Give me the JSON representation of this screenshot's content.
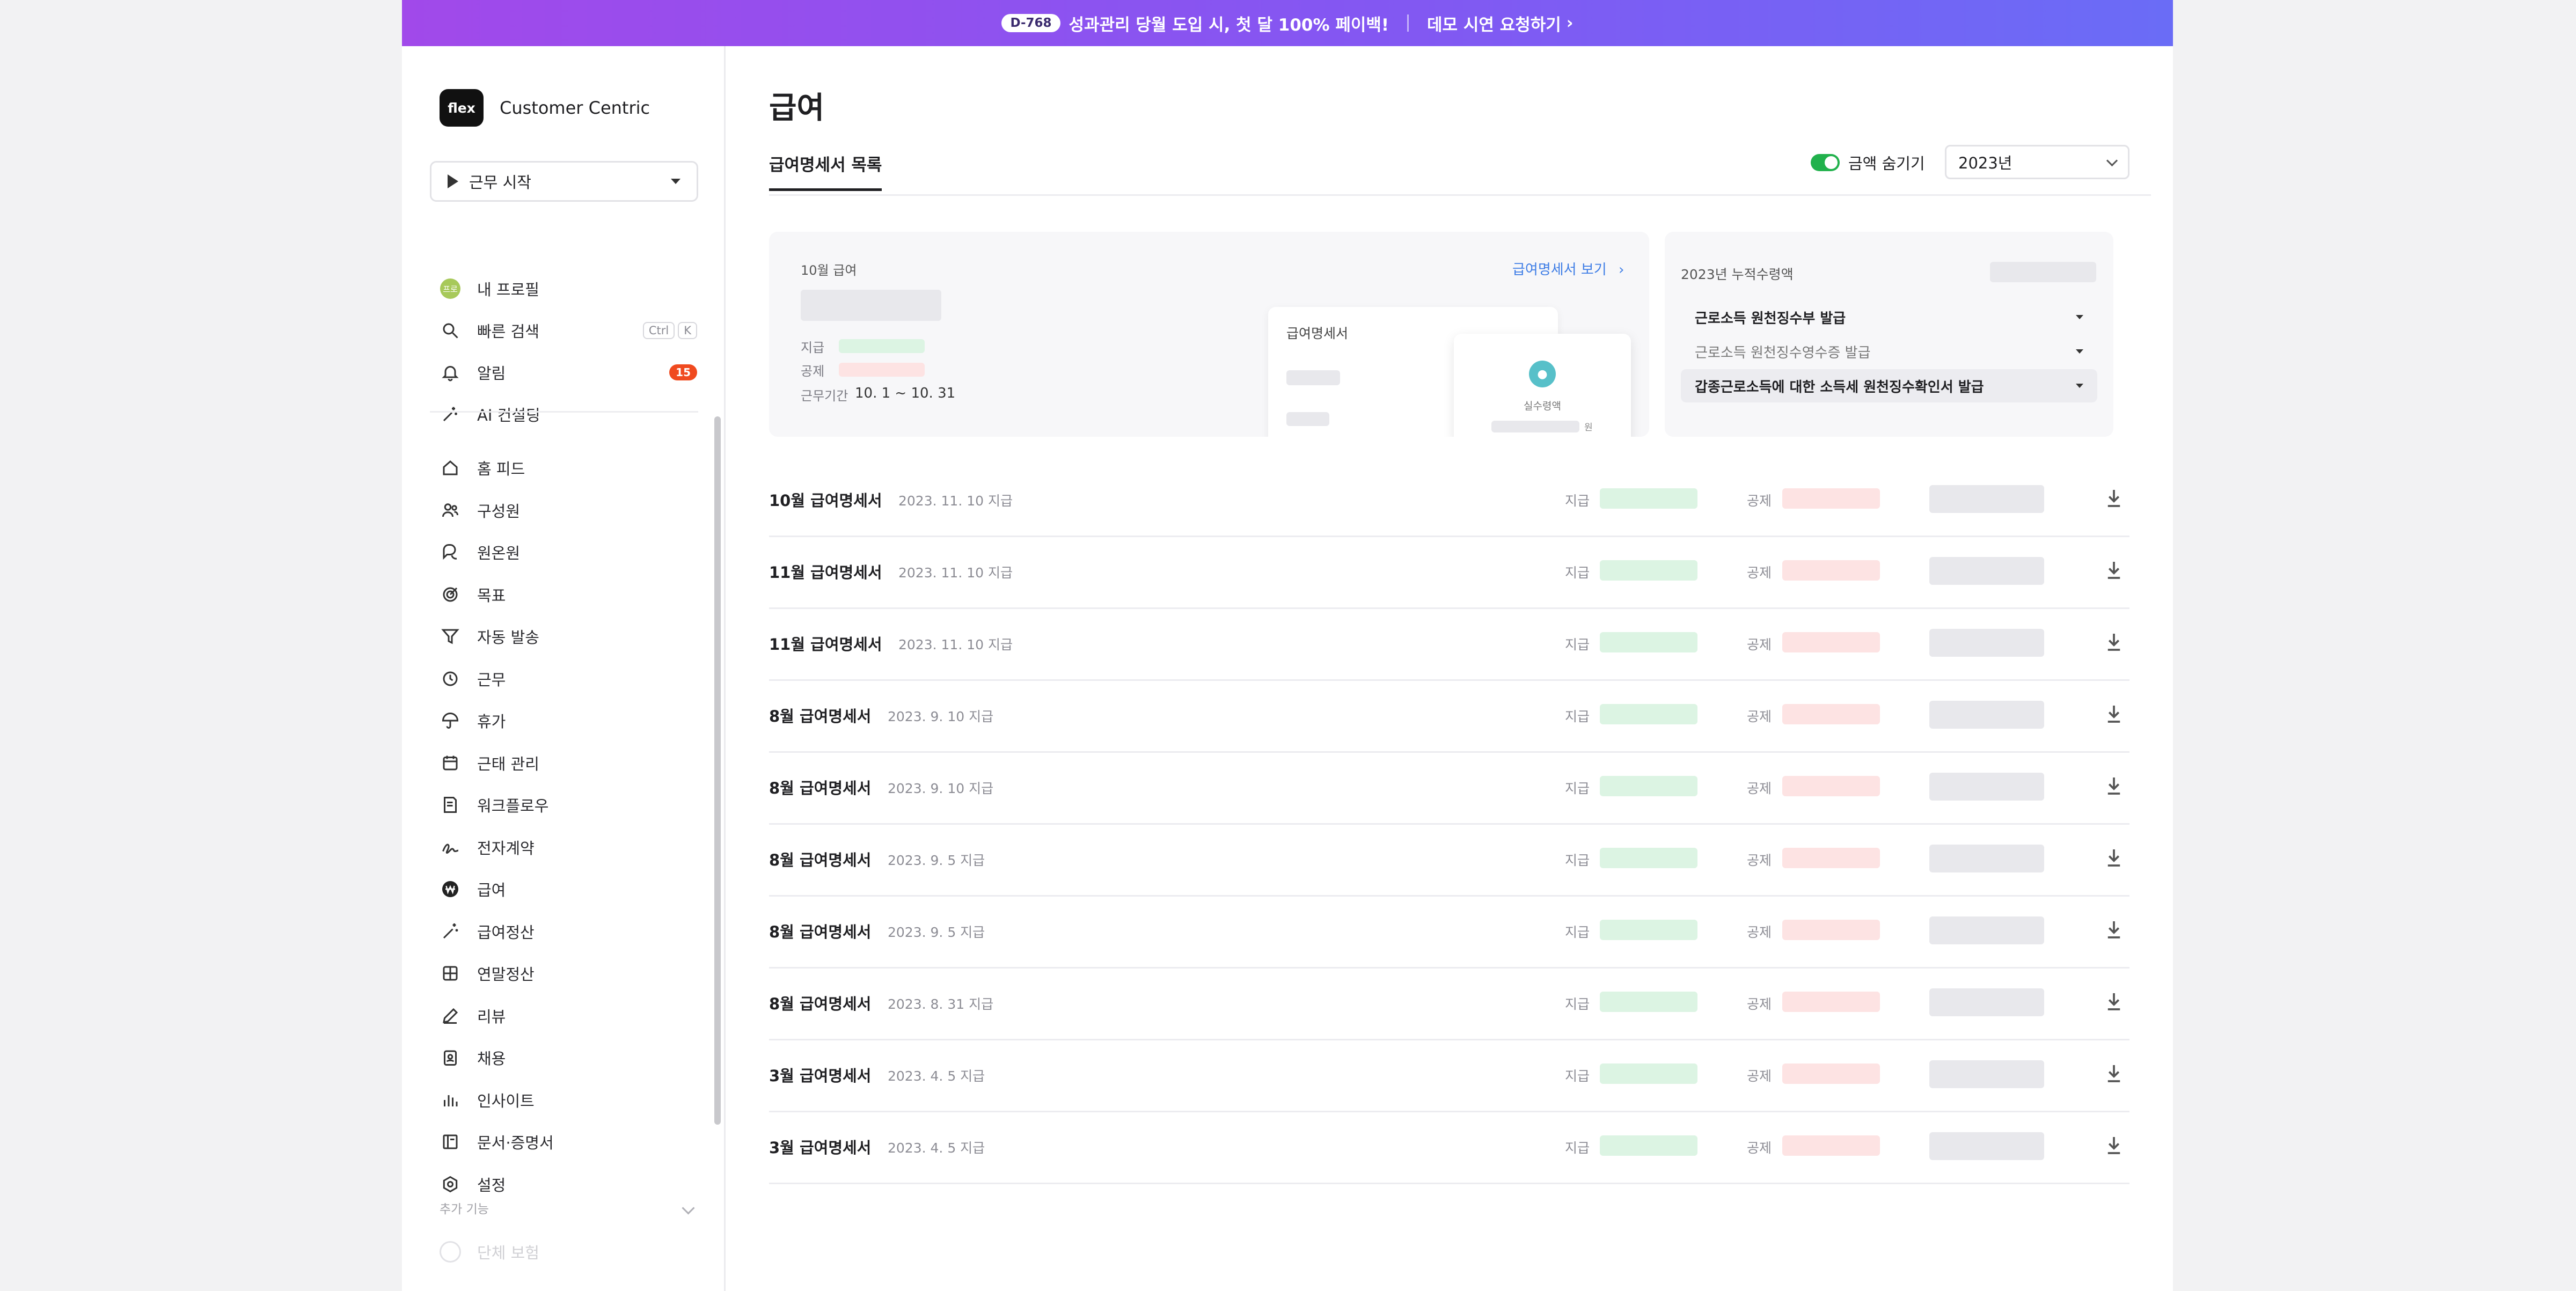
{
  "banner": {
    "dday": "D-768",
    "promo": "성과관리 당월 도입 시, 첫 달 100% 페이백!",
    "cta": "데모 시연 요청하기",
    "chevron": "›"
  },
  "sidebar": {
    "logo": "flex",
    "company": "Customer Centric",
    "work_start": "근무 시작",
    "quick_items": [
      {
        "label": "내 프로필",
        "icon": "profile-avatar",
        "avatar_text": "프로"
      },
      {
        "label": "빠른 검색",
        "icon": "search-icon",
        "shortcut": [
          "Ctrl",
          "K"
        ]
      },
      {
        "label": "알림",
        "icon": "bell-icon",
        "badge": "15"
      },
      {
        "label": "AI 컨설팅",
        "icon": "sparkle-icon"
      }
    ],
    "menu": [
      {
        "label": "홈 피드",
        "icon": "home-icon"
      },
      {
        "label": "구성원",
        "icon": "people-icon"
      },
      {
        "label": "원온원",
        "icon": "chat-icon"
      },
      {
        "label": "목표",
        "icon": "target-icon"
      },
      {
        "label": "자동 발송",
        "icon": "send-icon"
      },
      {
        "label": "근무",
        "icon": "clock-icon"
      },
      {
        "label": "휴가",
        "icon": "umbrella-icon"
      },
      {
        "label": "근태 관리",
        "icon": "calendar-icon"
      },
      {
        "label": "워크플로우",
        "icon": "document-icon"
      },
      {
        "label": "전자계약",
        "icon": "signature-icon"
      },
      {
        "label": "급여",
        "icon": "won-icon"
      },
      {
        "label": "급여정산",
        "icon": "wand-icon"
      },
      {
        "label": "연말정산",
        "icon": "grid-icon"
      },
      {
        "label": "리뷰",
        "icon": "pen-icon"
      },
      {
        "label": "채용",
        "icon": "badge-icon"
      },
      {
        "label": "인사이트",
        "icon": "bar-chart-icon"
      },
      {
        "label": "문서·증명서",
        "icon": "docs-icon"
      },
      {
        "label": "설정",
        "icon": "gear-icon"
      }
    ],
    "extra_label": "추가 기능",
    "faded_item": "단체 보험"
  },
  "main": {
    "title": "급여",
    "tab": "급여명세서 목록",
    "toggle_label": "금액 숨기기",
    "year": "2023년",
    "summary": {
      "title": "10월 급여",
      "link": "급여명세서 보기",
      "pay_label": "지급",
      "deduct_label": "공제",
      "period_label": "근무기간",
      "period_value": "10. 1 ~ 10. 31",
      "preview_title": "급여명세서",
      "preview_net": "실수령액",
      "preview_won": "원"
    },
    "cumulative": {
      "title": "2023년 누적수령액",
      "items": [
        "근로소득 원천징수부 발급",
        "근로소득 원천징수영수증 발급",
        "갑종근로소득에 대한 소득세 원천징수확인서 발급"
      ]
    },
    "pay_label": "지급",
    "deduct_label": "공제",
    "rows": [
      {
        "name": "10월 급여명세서",
        "date": "2023. 11. 10 지급"
      },
      {
        "name": "11월 급여명세서",
        "date": "2023. 11. 10 지급"
      },
      {
        "name": "11월 급여명세서",
        "date": "2023. 11. 10 지급"
      },
      {
        "name": "8월 급여명세서",
        "date": "2023. 9. 10 지급"
      },
      {
        "name": "8월 급여명세서",
        "date": "2023. 9. 10 지급"
      },
      {
        "name": "8월 급여명세서",
        "date": "2023. 9. 5 지급"
      },
      {
        "name": "8월 급여명세서",
        "date": "2023. 9. 5 지급"
      },
      {
        "name": "8월 급여명세서",
        "date": "2023. 8. 31 지급"
      },
      {
        "name": "3월 급여명세서",
        "date": "2023. 4. 5 지급"
      },
      {
        "name": "3월 급여명세서",
        "date": "2023. 4. 5 지급"
      }
    ]
  },
  "colors": {
    "banner_start": "#a149ea",
    "banner_end": "#6a6cf6",
    "toggle_on": "#21b14c",
    "badge": "#f04a1f",
    "link": "#3e7de6"
  }
}
